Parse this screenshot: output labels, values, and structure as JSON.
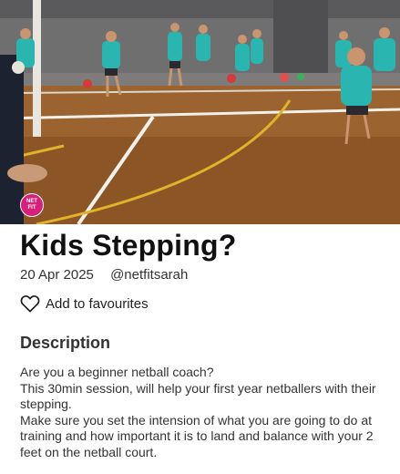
{
  "hero": {
    "image_description_icon": "netball-training-photo",
    "logo_text_line1": "NET",
    "logo_text_line2": "FIT",
    "logo_color": "#d91f7a"
  },
  "session": {
    "title": "Kids Stepping?",
    "date": "20 Apr 2025",
    "author": "@netfitsarah"
  },
  "favourite": {
    "icon": "heart-outline-icon",
    "label": "Add to favourites"
  },
  "description": {
    "heading": "Description",
    "lines": [
      "Are you a beginner netball coach?",
      "This 30min session, will help your first year netballers with their stepping.",
      "Make sure you set the intension of what you are going to do at training and how important it is to land and balance with your 2 feet on the netball court."
    ]
  }
}
